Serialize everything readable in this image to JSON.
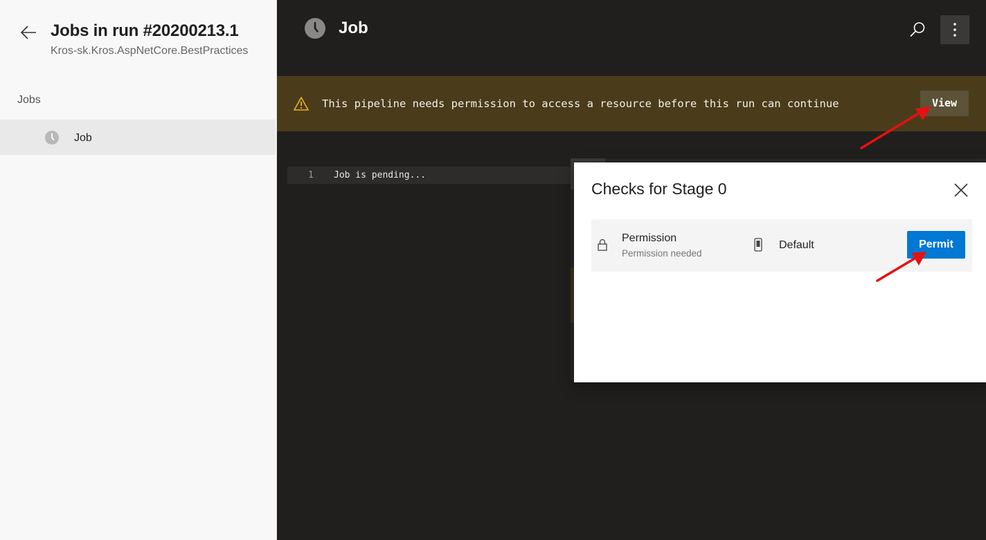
{
  "sidebar": {
    "title": "Jobs in run #20200213.1",
    "subtitle": "Kros-sk.Kros.AspNetCore.BestPractices",
    "section_label": "Jobs",
    "jobs": [
      {
        "label": "Job",
        "status": "pending"
      }
    ]
  },
  "header": {
    "title": "Job",
    "status_icon": "clock-icon",
    "search_icon": "search-icon",
    "more_icon": "more-vertical-icon"
  },
  "banner": {
    "message": "This pipeline needs permission to access a resource before this run can continue",
    "button_label": "View",
    "background": "#4a3c1b",
    "icon": "warning-icon"
  },
  "log": {
    "lines": [
      {
        "number": "1",
        "text": "Job is pending..."
      }
    ]
  },
  "modal": {
    "title": "Checks for Stage 0",
    "checks": [
      {
        "name": "Permission",
        "status": "Permission needed",
        "resource": "Default",
        "action_label": "Permit"
      }
    ],
    "accent": "#0078d4"
  },
  "annotation_color": "#e81010"
}
